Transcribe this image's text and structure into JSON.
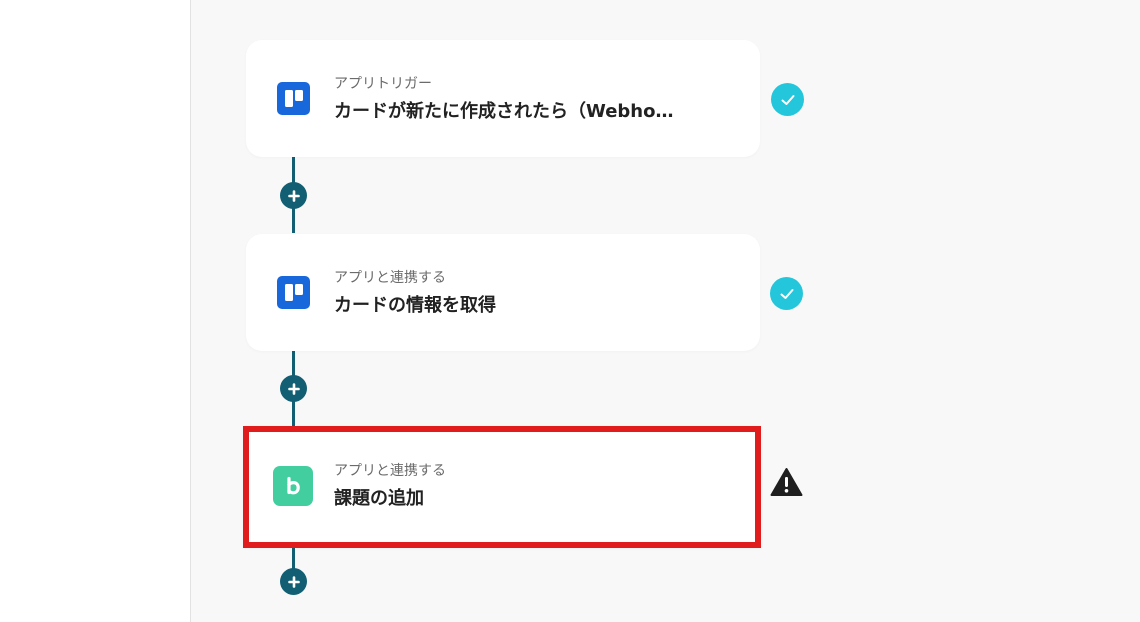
{
  "colors": {
    "flow_line": "#125f73",
    "check_badge": "#23c6da",
    "highlight_border": "#e01c1c",
    "trello_blue": "#1868db",
    "backlog_green": "#42ce9f"
  },
  "flow": {
    "steps": [
      {
        "label": "アプリトリガー",
        "title": "カードが新たに作成されたら（Webhook）",
        "icon": "trello-icon",
        "status": "check-icon"
      },
      {
        "label": "アプリと連携する",
        "title": "カードの情報を取得",
        "icon": "trello-icon",
        "status": "check-icon"
      },
      {
        "label": "アプリと連携する",
        "title": "課題の追加",
        "icon": "backlog-icon",
        "status": "warning-icon"
      }
    ],
    "add_button_icon": "plus-icon"
  }
}
